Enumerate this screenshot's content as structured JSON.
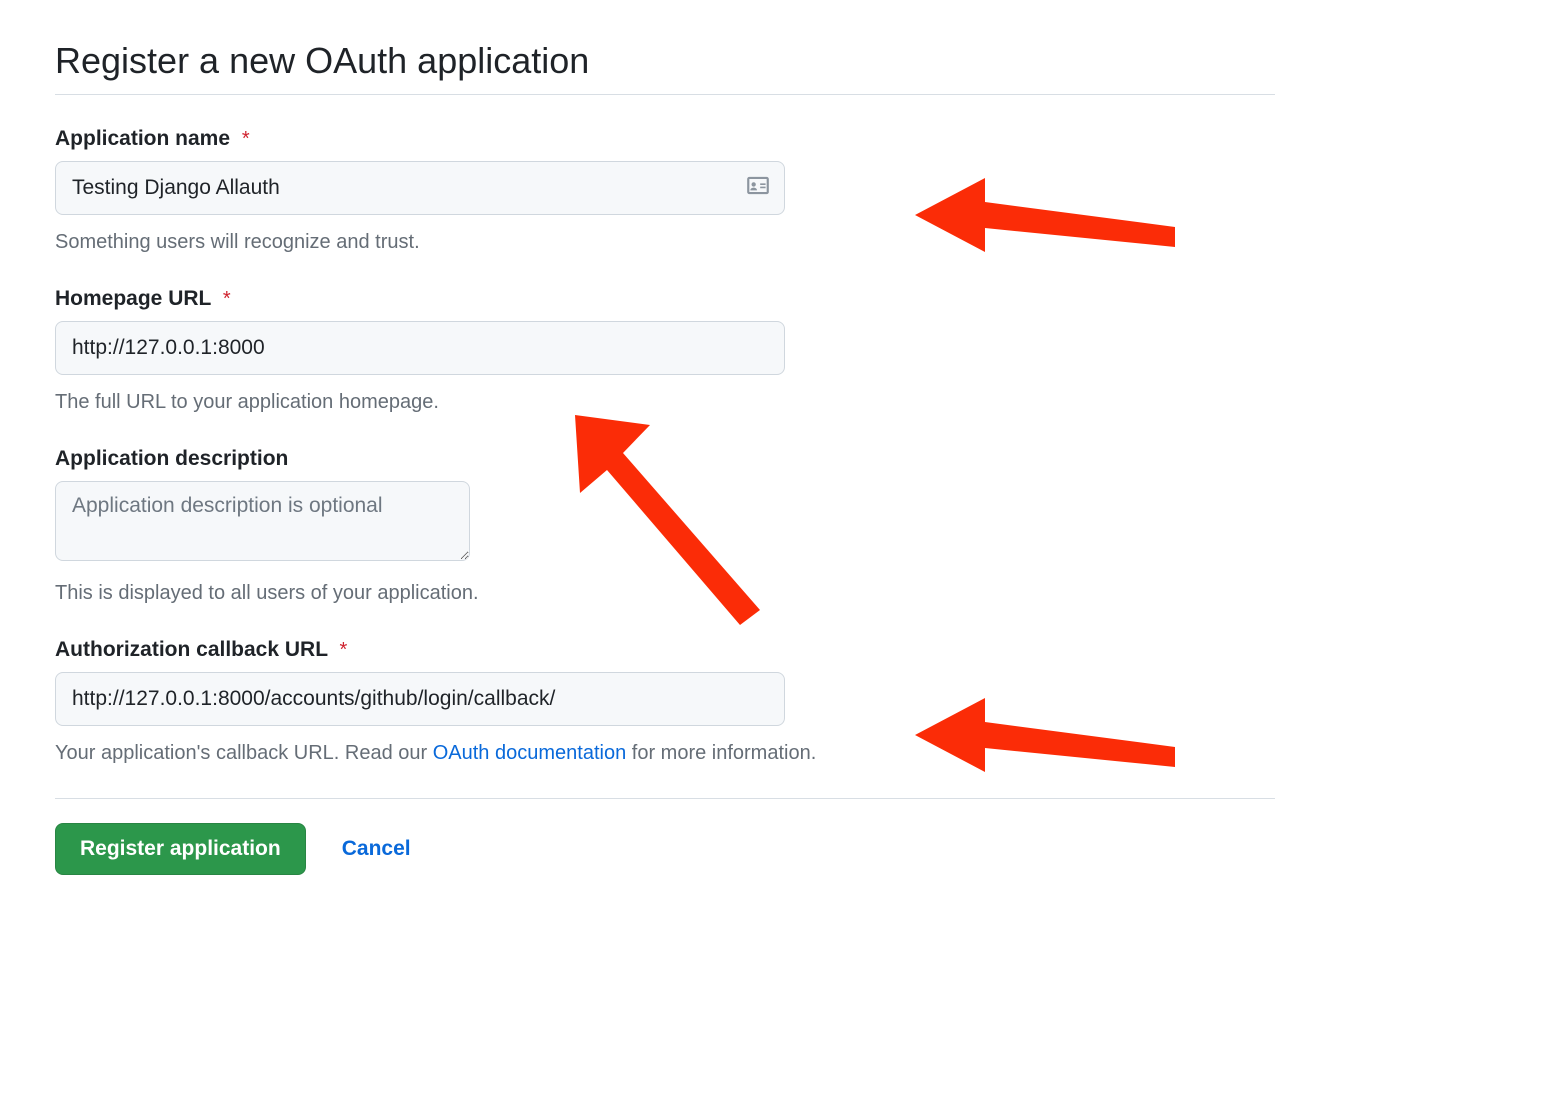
{
  "page_title": "Register a new OAuth application",
  "fields": {
    "app_name": {
      "label": "Application name",
      "required": true,
      "value": "Testing Django Allauth",
      "help": "Something users will recognize and trust."
    },
    "homepage_url": {
      "label": "Homepage URL",
      "required": true,
      "value": "http://127.0.0.1:8000",
      "help": "The full URL to your application homepage."
    },
    "description": {
      "label": "Application description",
      "required": false,
      "value": "",
      "placeholder": "Application description is optional",
      "help": "This is displayed to all users of your application."
    },
    "callback_url": {
      "label": "Authorization callback URL",
      "required": true,
      "value": "http://127.0.0.1:8000/accounts/github/login/callback/",
      "help_prefix": "Your application's callback URL. Read our ",
      "help_link_text": "OAuth documentation",
      "help_suffix": " for more information."
    }
  },
  "actions": {
    "submit_label": "Register application",
    "cancel_label": "Cancel"
  },
  "required_marker": "*",
  "colors": {
    "primary_button": "#2c974b",
    "link": "#0969da",
    "required": "#cf222e",
    "annotation_arrow": "#fb2c07"
  }
}
